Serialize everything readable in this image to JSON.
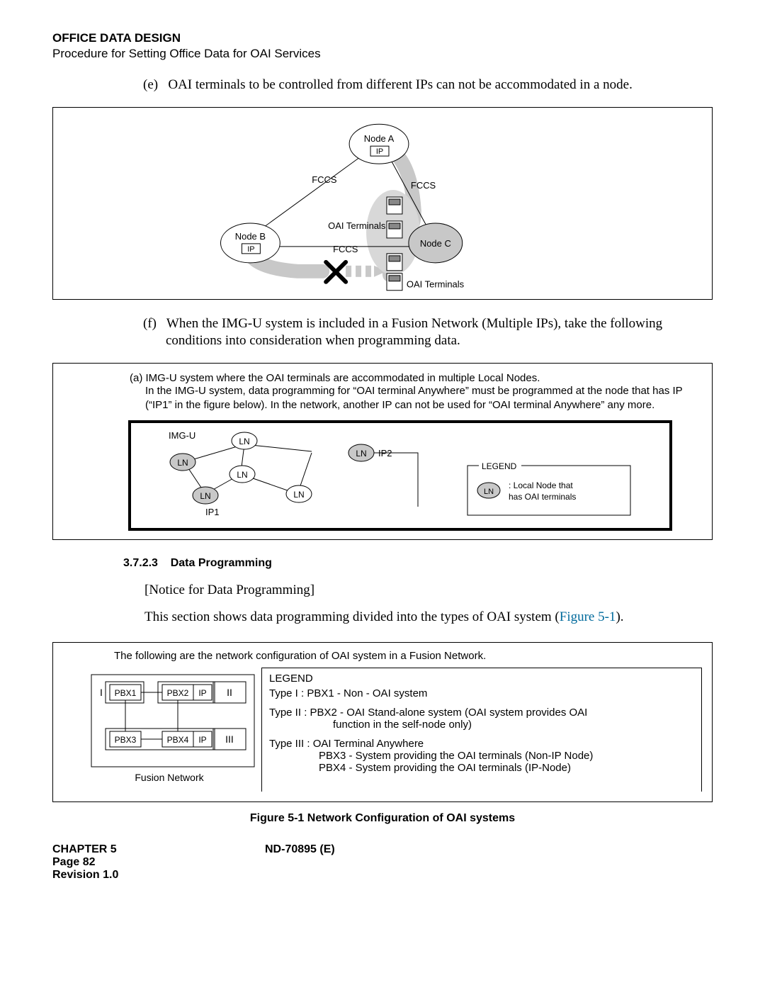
{
  "header": {
    "title": "OFFICE DATA DESIGN",
    "subtitle": "Procedure for Setting Office Data for OAI Services"
  },
  "item_e": {
    "marker": "(e)",
    "text": "OAI terminals to be controlled from different IPs can not be accommodated in a node."
  },
  "diagram1": {
    "nodeA": "Node A",
    "nodeB": "Node B",
    "nodeC": "Node C",
    "ip": "IP",
    "fccs": "FCCS",
    "oai_terminals": "OAI Terminals"
  },
  "item_f": {
    "marker": "(f)",
    "text": "When the IMG-U system is included in a Fusion Network (Multiple IPs), take the following conditions into consideration when programming data."
  },
  "box2": {
    "line_a": "(a) IMG-U system where the OAI terminals are accommodated in multiple Local Nodes.",
    "line_a2": "In the IMG-U system, data programming for “OAI terminal Anywhere” must be programmed at the node that has IP (“IP1” in the figure below). In the network, another IP can not be used for “OAI terminal Anywhere” any more.",
    "imgU": "IMG-U",
    "ln": "LN",
    "ip1": "IP1",
    "ip2": "IP2",
    "legend_title": "LEGEND",
    "legend_ln": "LN",
    "legend_text1": ": Local Node that",
    "legend_text2": "  has OAI terminals"
  },
  "section": {
    "number": "3.7.2.3",
    "title": "Data Programming"
  },
  "notice": "[Notice for Data Programming]",
  "section_text": "This section shows data programming divided into the types of OAI system (",
  "figref": "Figure 5-1",
  "section_text_end": ").",
  "box3": {
    "intro": "The following are the network configuration of OAI system in a Fusion Network.",
    "pbx1": "PBX1",
    "pbx2": "PBX2",
    "pbx3": "PBX3",
    "pbx4": "PBX4",
    "ip": "IP",
    "I": "I",
    "II": "II",
    "III": "III",
    "fusion": "Fusion Network",
    "legend": "LEGEND",
    "t1": "Type I  :  PBX1 - Non - OAI system",
    "t2a": "Type II  : PBX2 - OAI Stand-alone system (OAI system provides OAI",
    "t2b": "function in the self-node only)",
    "t3a": "Type III : OAI Terminal Anywhere",
    "t3b": "PBX3 - System providing the OAI terminals (Non-IP Node)",
    "t3c": "PBX4 - System providing the OAI terminals (IP-Node)"
  },
  "figure_caption": "Figure 5-1   Network Configuration of OAI systems",
  "footer": {
    "chapter": "CHAPTER 5",
    "doc": "ND-70895 (E)",
    "page": "Page 82",
    "rev": "Revision 1.0"
  }
}
